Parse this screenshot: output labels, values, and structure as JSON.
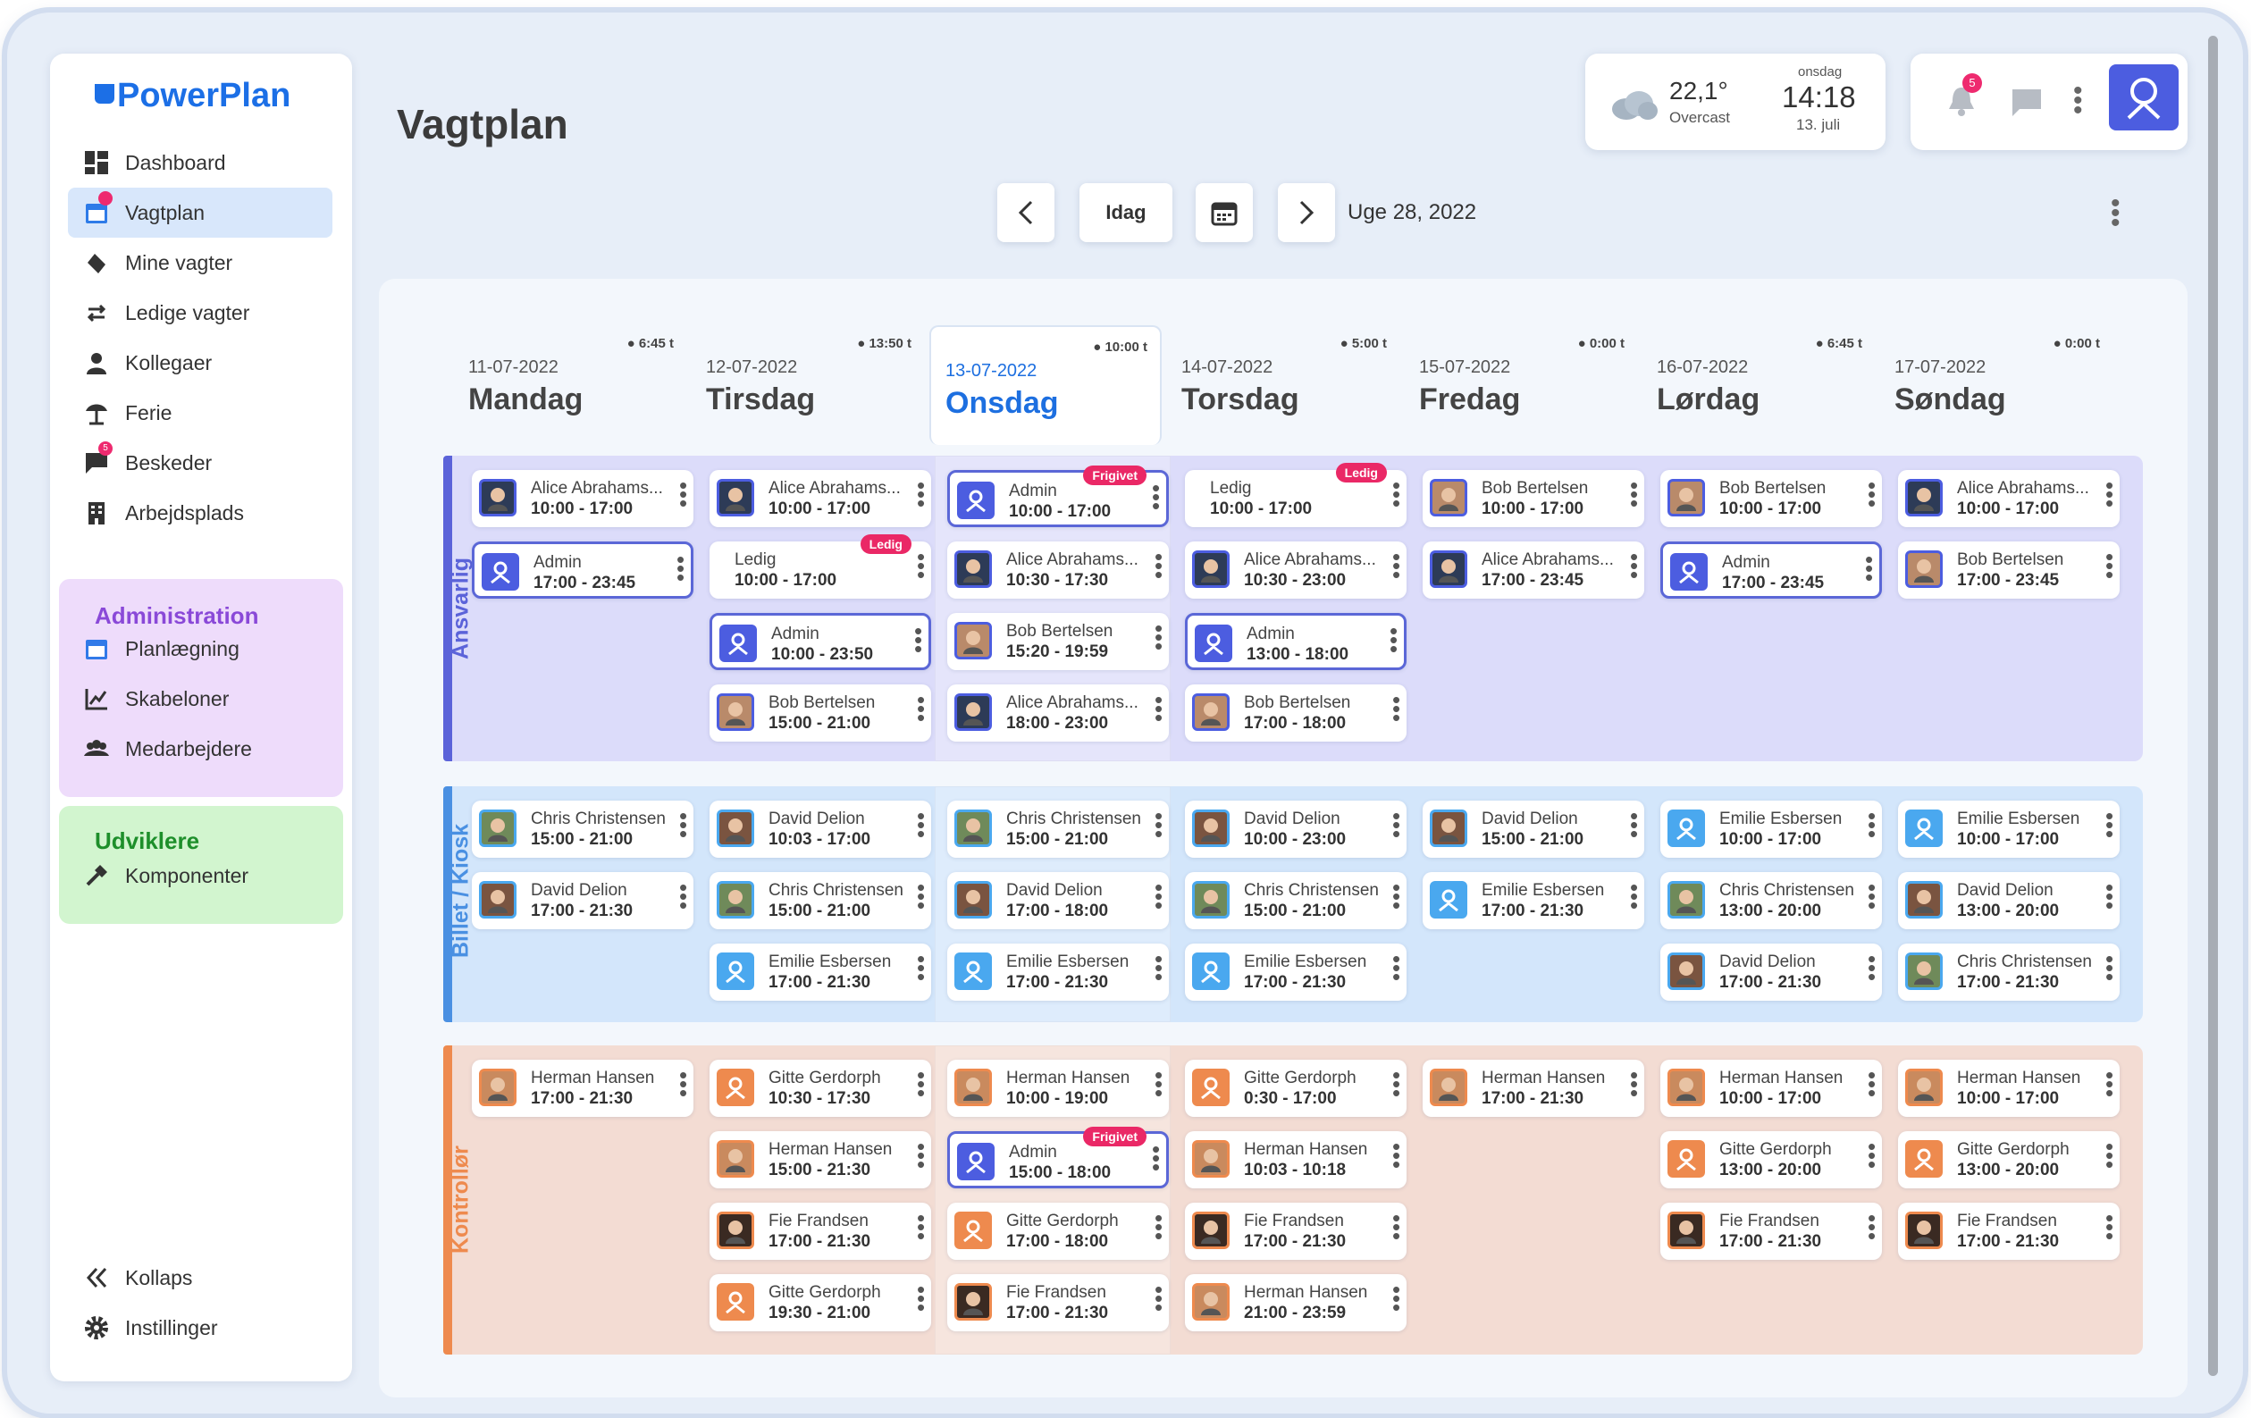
{
  "app": {
    "name": "PowerPlan",
    "page_title": "Vagtplan"
  },
  "sidebar": {
    "items": [
      {
        "label": "Dashboard",
        "icon": "dashboard-icon"
      },
      {
        "label": "Vagtplan",
        "icon": "calendar-icon",
        "active": true
      },
      {
        "label": "Mine vagter",
        "icon": "hand-icon"
      },
      {
        "label": "Ledige vagter",
        "icon": "swap-icon"
      },
      {
        "label": "Kollegaer",
        "icon": "person-icon"
      },
      {
        "label": "Ferie",
        "icon": "beach-icon"
      },
      {
        "label": "Beskeder",
        "icon": "chat-icon",
        "badge": "5"
      },
      {
        "label": "Arbejdsplads",
        "icon": "building-icon"
      }
    ],
    "admin": {
      "title": "Administration",
      "items": [
        {
          "label": "Planlægning",
          "icon": "calendar-icon"
        },
        {
          "label": "Skabeloner",
          "icon": "chart-icon"
        },
        {
          "label": "Medarbejdere",
          "icon": "group-icon"
        }
      ]
    },
    "dev": {
      "title": "Udviklere",
      "items": [
        {
          "label": "Komponenter",
          "icon": "hammer-icon"
        }
      ]
    },
    "footer": [
      {
        "label": "Kollaps",
        "icon": "collapse-icon"
      },
      {
        "label": "Instillinger",
        "icon": "gear-icon"
      }
    ]
  },
  "weather": {
    "temp": "22,1°",
    "desc": "Overcast",
    "day": "onsdag",
    "time": "14:18",
    "date": "13. juli"
  },
  "notifications": {
    "count": "5"
  },
  "toolbar": {
    "today": "Idag",
    "week": "Uge 28, 2022"
  },
  "days": [
    {
      "date": "11-07-2022",
      "name": "Mandag",
      "hours": "6:45 t"
    },
    {
      "date": "12-07-2022",
      "name": "Tirsdag",
      "hours": "13:50 t"
    },
    {
      "date": "13-07-2022",
      "name": "Onsdag",
      "hours": "10:00 t",
      "selected": true
    },
    {
      "date": "14-07-2022",
      "name": "Torsdag",
      "hours": "5:00 t"
    },
    {
      "date": "15-07-2022",
      "name": "Fredag",
      "hours": "0:00 t"
    },
    {
      "date": "16-07-2022",
      "name": "Lørdag",
      "hours": "6:45 t"
    },
    {
      "date": "17-07-2022",
      "name": "Søndag",
      "hours": "0:00 t"
    }
  ],
  "sections": [
    {
      "label": "Ansvarlig",
      "color": "#5b63d9",
      "bg": "#dcdcfa",
      "days": [
        [
          {
            "name": "Alice Abrahams...",
            "time": "10:00 - 17:00",
            "av": "alice"
          },
          {
            "name": "Admin",
            "time": "17:00 - 23:45",
            "av": "admin",
            "me": true
          }
        ],
        [
          {
            "name": "Alice Abrahams...",
            "time": "10:00 - 17:00",
            "av": "alice"
          },
          {
            "name": "Ledig",
            "time": "10:00 - 17:00",
            "tag": "Ledig"
          },
          {
            "name": "Admin",
            "time": "10:00 - 23:50",
            "av": "admin",
            "me": true
          },
          {
            "name": "Bob Bertelsen",
            "time": "15:00 - 21:00",
            "av": "bob"
          }
        ],
        [
          {
            "name": "Admin",
            "time": "10:00 - 17:00",
            "av": "admin",
            "me": true,
            "tag": "Frigivet"
          },
          {
            "name": "Alice Abrahams...",
            "time": "10:30 - 17:30",
            "av": "alice"
          },
          {
            "name": "Bob Bertelsen",
            "time": "15:20 - 19:59",
            "av": "bob"
          },
          {
            "name": "Alice Abrahams...",
            "time": "18:00 - 23:00",
            "av": "alice"
          }
        ],
        [
          {
            "name": "Ledig",
            "time": "10:00 - 17:00",
            "tag": "Ledig"
          },
          {
            "name": "Alice Abrahams...",
            "time": "10:30 - 23:00",
            "av": "alice"
          },
          {
            "name": "Admin",
            "time": "13:00 - 18:00",
            "av": "admin",
            "me": true
          },
          {
            "name": "Bob Bertelsen",
            "time": "17:00 - 18:00",
            "av": "bob"
          }
        ],
        [
          {
            "name": "Bob Bertelsen",
            "time": "10:00 - 17:00",
            "av": "bob"
          },
          {
            "name": "Alice Abrahams...",
            "time": "17:00 - 23:45",
            "av": "alice"
          }
        ],
        [
          {
            "name": "Bob Bertelsen",
            "time": "10:00 - 17:00",
            "av": "bob"
          },
          {
            "name": "Admin",
            "time": "17:00 - 23:45",
            "av": "admin",
            "me": true
          }
        ],
        [
          {
            "name": "Alice Abrahams...",
            "time": "10:00 - 17:00",
            "av": "alice"
          },
          {
            "name": "Bob Bertelsen",
            "time": "17:00 - 23:45",
            "av": "bob"
          }
        ]
      ]
    },
    {
      "label": "Billet / Kiosk",
      "color": "#4a90e2",
      "bg": "#d3e6fb",
      "days": [
        [
          {
            "name": "Chris Christensen",
            "time": "15:00 - 21:00",
            "av": "chris"
          },
          {
            "name": "David Delion",
            "time": "17:00 - 21:30",
            "av": "david"
          }
        ],
        [
          {
            "name": "David Delion",
            "time": "10:03 - 17:00",
            "av": "david"
          },
          {
            "name": "Chris Christensen",
            "time": "15:00 - 21:00",
            "av": "chris"
          },
          {
            "name": "Emilie Esbersen",
            "time": "17:00 - 21:30",
            "av": "emilie"
          }
        ],
        [
          {
            "name": "Chris Christensen",
            "time": "15:00 - 21:00",
            "av": "chris"
          },
          {
            "name": "David Delion",
            "time": "17:00 - 18:00",
            "av": "david"
          },
          {
            "name": "Emilie Esbersen",
            "time": "17:00 - 21:30",
            "av": "emilie"
          }
        ],
        [
          {
            "name": "David Delion",
            "time": "10:00 - 23:00",
            "av": "david"
          },
          {
            "name": "Chris Christensen",
            "time": "15:00 - 21:00",
            "av": "chris"
          },
          {
            "name": "Emilie Esbersen",
            "time": "17:00 - 21:30",
            "av": "emilie"
          }
        ],
        [
          {
            "name": "David Delion",
            "time": "15:00 - 21:00",
            "av": "david"
          },
          {
            "name": "Emilie Esbersen",
            "time": "17:00 - 21:30",
            "av": "emilie"
          }
        ],
        [
          {
            "name": "Emilie Esbersen",
            "time": "10:00 - 17:00",
            "av": "emilie"
          },
          {
            "name": "Chris Christensen",
            "time": "13:00 - 20:00",
            "av": "chris"
          },
          {
            "name": "David Delion",
            "time": "17:00 - 21:30",
            "av": "david"
          }
        ],
        [
          {
            "name": "Emilie Esbersen",
            "time": "10:00 - 17:00",
            "av": "emilie"
          },
          {
            "name": "David Delion",
            "time": "13:00 - 20:00",
            "av": "david"
          },
          {
            "name": "Chris Christensen",
            "time": "17:00 - 21:30",
            "av": "chris"
          }
        ]
      ]
    },
    {
      "label": "Kontrollør",
      "color": "#ee8a4e",
      "bg": "#f3dcd3",
      "days": [
        [
          {
            "name": "Herman Hansen",
            "time": "17:00 - 21:30",
            "av": "herman"
          }
        ],
        [
          {
            "name": "Gitte Gerdorph",
            "time": "10:30 - 17:30",
            "av": "gitte"
          },
          {
            "name": "Herman Hansen",
            "time": "15:00 - 21:30",
            "av": "herman"
          },
          {
            "name": "Fie Frandsen",
            "time": "17:00 - 21:30",
            "av": "fie"
          },
          {
            "name": "Gitte Gerdorph",
            "time": "19:30 - 21:00",
            "av": "gitte"
          }
        ],
        [
          {
            "name": "Herman Hansen",
            "time": "10:00 - 19:00",
            "av": "herman"
          },
          {
            "name": "Admin",
            "time": "15:00 - 18:00",
            "av": "admin",
            "me": true,
            "tag": "Frigivet"
          },
          {
            "name": "Gitte Gerdorph",
            "time": "17:00 - 18:00",
            "av": "gitte"
          },
          {
            "name": "Fie Frandsen",
            "time": "17:00 - 21:30",
            "av": "fie"
          }
        ],
        [
          {
            "name": "Gitte Gerdorph",
            "time": "0:30 - 17:00",
            "av": "gitte"
          },
          {
            "name": "Herman Hansen",
            "time": "10:03 - 10:18",
            "av": "herman"
          },
          {
            "name": "Fie Frandsen",
            "time": "17:00 - 21:30",
            "av": "fie"
          },
          {
            "name": "Herman Hansen",
            "time": "21:00 - 23:59",
            "av": "herman"
          }
        ],
        [
          {
            "name": "Herman Hansen",
            "time": "17:00 - 21:30",
            "av": "herman"
          }
        ],
        [
          {
            "name": "Herman Hansen",
            "time": "10:00 - 17:00",
            "av": "herman"
          },
          {
            "name": "Gitte Gerdorph",
            "time": "13:00 - 20:00",
            "av": "gitte"
          },
          {
            "name": "Fie Frandsen",
            "time": "17:00 - 21:30",
            "av": "fie"
          }
        ],
        [
          {
            "name": "Herman Hansen",
            "time": "10:00 - 17:00",
            "av": "herman"
          },
          {
            "name": "Gitte Gerdorph",
            "time": "13:00 - 20:00",
            "av": "gitte"
          },
          {
            "name": "Fie Frandsen",
            "time": "17:00 - 21:30",
            "av": "fie"
          }
        ]
      ]
    }
  ],
  "avatar_colors": {
    "alice": "#2d3b57",
    "bob": "#b98a6a",
    "admin": "#4c5de0",
    "chris": "#6f8a5a",
    "david": "#7a5440",
    "emilie": "#4aa8ef",
    "herman": "#c98a5e",
    "gitte": "#ee8a4e",
    "fie": "#3a2a22"
  }
}
